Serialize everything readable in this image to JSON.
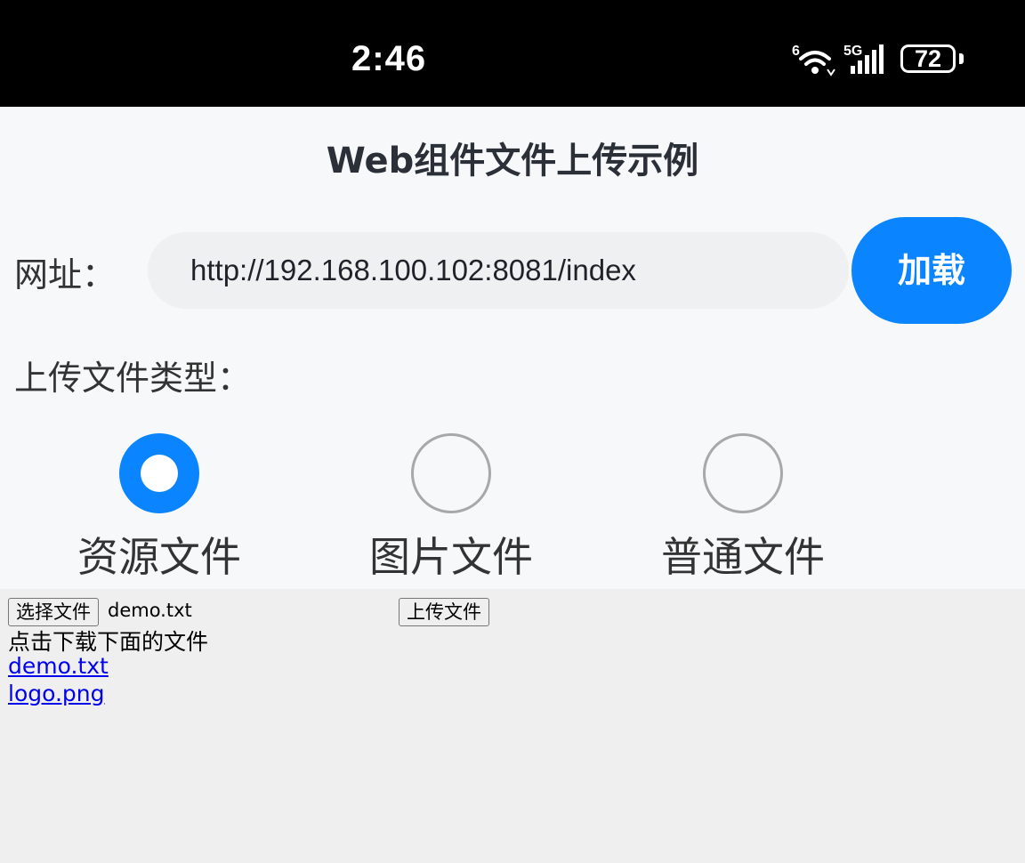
{
  "status_bar": {
    "time": "2:46",
    "wifi_badge": "6",
    "network": "5G",
    "battery": "72",
    "icons": [
      "wifi-icon",
      "signal-icon",
      "battery-icon"
    ]
  },
  "app": {
    "title": "Web组件文件上传示例",
    "url_label": "网址：",
    "url_value": "http://192.168.100.102:8081/index",
    "load_button": "加载",
    "type_label": "上传文件类型：",
    "accent_color": "#0a84ff",
    "radio_options": [
      {
        "label": "资源文件",
        "checked": true
      },
      {
        "label": "图片文件",
        "checked": false
      },
      {
        "label": "普通文件",
        "checked": false
      }
    ]
  },
  "web": {
    "choose_button": "选择文件",
    "file_name": "demo.txt",
    "upload_button": "上传文件",
    "download_text": "点击下载下面的文件",
    "links": [
      "demo.txt",
      "logo.png"
    ]
  }
}
